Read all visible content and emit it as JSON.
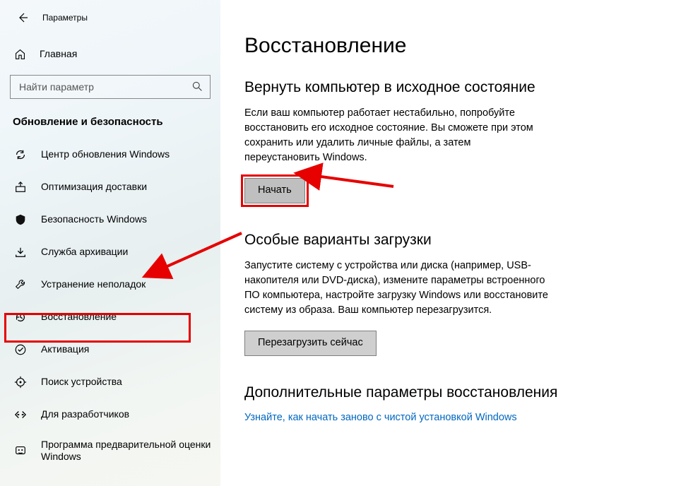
{
  "window_title": "Параметры",
  "home_label": "Главная",
  "search_placeholder": "Найти параметр",
  "category_label": "Обновление и безопасность",
  "nav": [
    {
      "key": "update",
      "label": "Центр обновления Windows"
    },
    {
      "key": "delivery",
      "label": "Оптимизация доставки"
    },
    {
      "key": "security",
      "label": "Безопасность Windows"
    },
    {
      "key": "backup",
      "label": "Служба архивации"
    },
    {
      "key": "troubleshoot",
      "label": "Устранение неполадок"
    },
    {
      "key": "recovery",
      "label": "Восстановление"
    },
    {
      "key": "activation",
      "label": "Активация"
    },
    {
      "key": "finddevice",
      "label": "Поиск устройства"
    },
    {
      "key": "developers",
      "label": "Для разработчиков"
    },
    {
      "key": "insider",
      "label": "Программа предварительной оценки Windows"
    }
  ],
  "page": {
    "title": "Восстановление",
    "reset": {
      "heading": "Вернуть компьютер в исходное состояние",
      "text": "Если ваш компьютер работает нестабильно, попробуйте восстановить его исходное состояние. Вы сможете при этом сохранить или удалить личные файлы, а затем переустановить Windows.",
      "button": "Начать"
    },
    "advboot": {
      "heading": "Особые варианты загрузки",
      "text": "Запустите систему с устройства или диска (например, USB-накопителя или DVD-диска), измените параметры встроенного ПО компьютера, настройте загрузку Windows или восстановите систему из образа. Ваш компьютер перезагрузится.",
      "button": "Перезагрузить сейчас"
    },
    "more": {
      "heading": "Дополнительные параметры восстановления",
      "link": "Узнайте, как начать заново с чистой установкой Windows"
    }
  }
}
